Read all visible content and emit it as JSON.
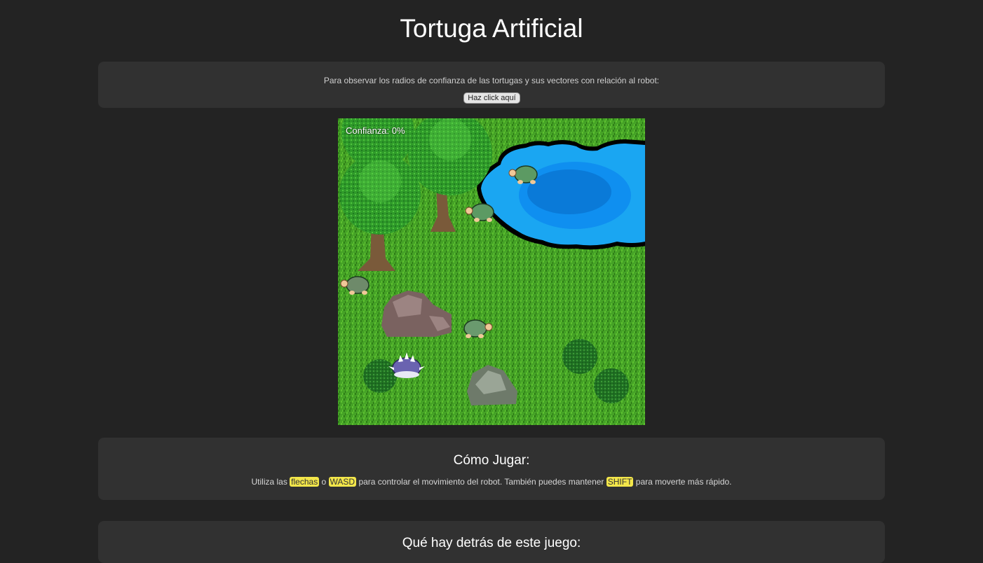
{
  "page": {
    "title": "Tortuga Artificial"
  },
  "info": {
    "text": "Para observar los radios de confianza de las tortugas y sus vectores con relación al robot:",
    "button_label": "Haz click aquí"
  },
  "game": {
    "confidence_label": "Confianza: 0%",
    "confidence_value": 0
  },
  "howto": {
    "heading": "Cómo Jugar:",
    "text_1": "Utiliza las ",
    "key_1": "flechas",
    "text_2": " o ",
    "key_2": "WASD",
    "text_3": " para controlar el movimiento del robot. También puedes mantener ",
    "key_3": "SHIFT",
    "text_4": " para moverte más rápido."
  },
  "behind": {
    "heading": "Qué hay detrás de este juego:"
  },
  "colors": {
    "background": "#232323",
    "panel": "#313131",
    "grass": "#3f9a22",
    "water": "#1aa0f0",
    "key_highlight": "#f3e64a"
  }
}
